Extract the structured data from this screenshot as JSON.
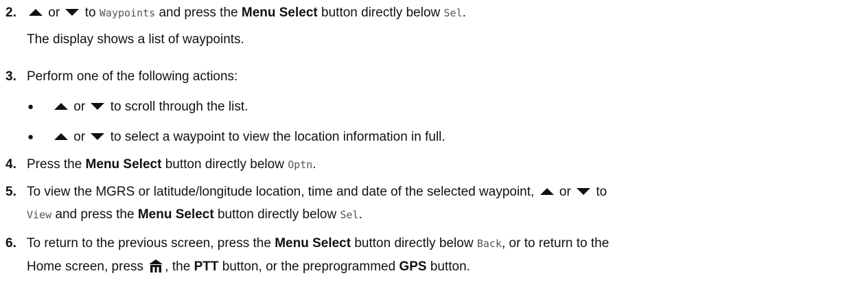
{
  "steps": {
    "s2": {
      "num": "2.",
      "or": "or",
      "t1": "to",
      "waypoints": "Waypoints",
      "t2": "and press the",
      "menu_select": "Menu Select",
      "t3": "button directly below",
      "sel": "Sel",
      "t4": ".",
      "sub": "The display shows a list of waypoints."
    },
    "s3": {
      "num": "3.",
      "text": "Perform one of the following actions:",
      "bullets": [
        {
          "or": "or",
          "text": "to scroll through the list."
        },
        {
          "or": "or",
          "text": "to select a waypoint to view the location information in full."
        }
      ]
    },
    "s4": {
      "num": "4.",
      "t1": "Press the",
      "menu_select": "Menu Select",
      "t2": "button directly below",
      "optn": "Optn",
      "t3": "."
    },
    "s5": {
      "num": "5.",
      "t1": "To view the MGRS or latitude/longitude location, time and date of the selected waypoint,",
      "or": "or",
      "t2": "to",
      "view": "View",
      "t3": "and press the",
      "menu_select": "Menu Select",
      "t4": "button directly below",
      "sel": "Sel",
      "t5": "."
    },
    "s6": {
      "num": "6.",
      "t1": "To return to the previous screen, press the",
      "menu_select": "Menu Select",
      "t2": "button directly below",
      "back": "Back",
      "t3": ", or to return to the",
      "t4": "Home screen, press",
      "t5": ", the",
      "ptt": "PTT",
      "t6": "button, or the preprogrammed",
      "gps": "GPS",
      "t7": "button."
    }
  },
  "icons": {
    "up": "up-arrow-icon",
    "down": "down-arrow-icon",
    "home": "home-icon"
  }
}
